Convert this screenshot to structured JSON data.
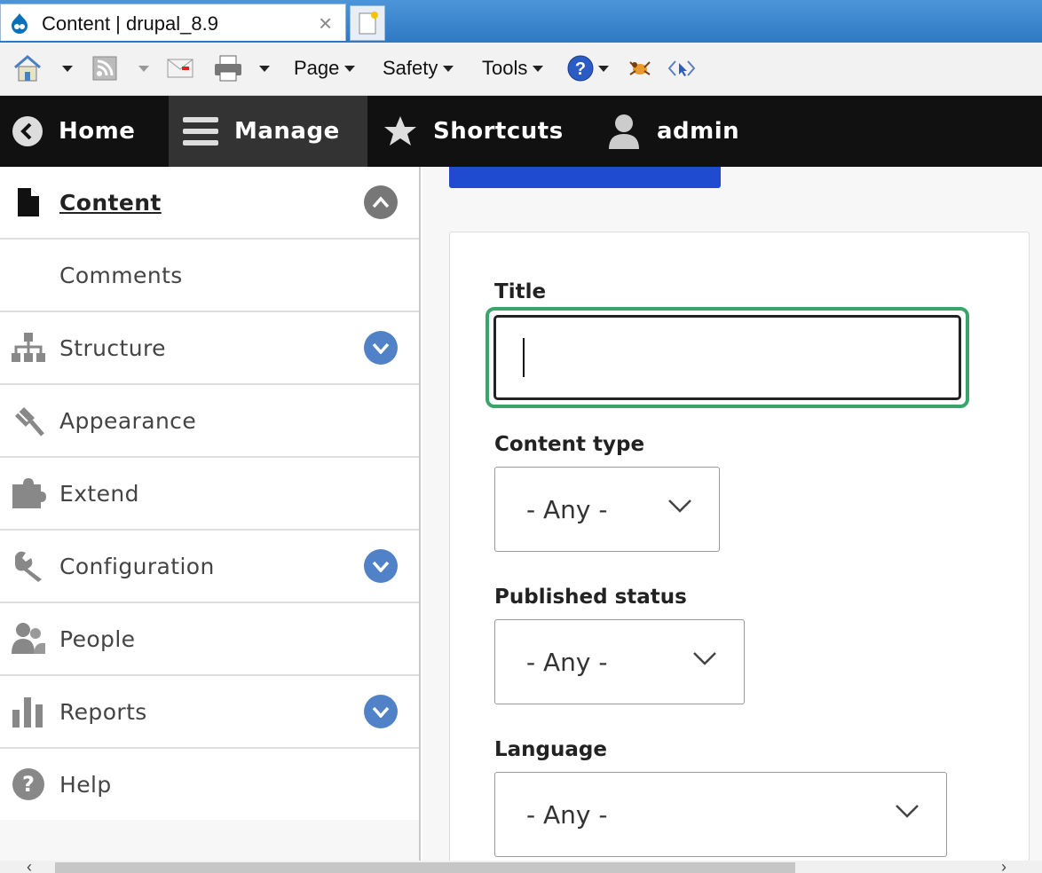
{
  "browser": {
    "tab_title": "Content | drupal_8.9",
    "tab_close": "×",
    "menu": {
      "page": "Page",
      "safety": "Safety",
      "tools": "Tools"
    }
  },
  "toolbar": {
    "home": "Home",
    "manage": "Manage",
    "shortcuts": "Shortcuts",
    "user": "admin"
  },
  "sidebar": {
    "items": [
      {
        "label": "Content",
        "icon": "file-icon",
        "expanded": true
      },
      {
        "label": "Comments"
      },
      {
        "label": "Structure",
        "icon": "sitemap-icon",
        "has_children": true
      },
      {
        "label": "Appearance",
        "icon": "paintbrush-icon"
      },
      {
        "label": "Extend",
        "icon": "puzzle-icon"
      },
      {
        "label": "Configuration",
        "icon": "wrench-icon",
        "has_children": true
      },
      {
        "label": "People",
        "icon": "people-icon"
      },
      {
        "label": "Reports",
        "icon": "bar-chart-icon",
        "has_children": true
      },
      {
        "label": "Help",
        "icon": "help-icon"
      }
    ]
  },
  "filters": {
    "title": {
      "label": "Title",
      "value": ""
    },
    "content_type": {
      "label": "Content type",
      "value": "- Any -"
    },
    "published_status": {
      "label": "Published status",
      "value": "- Any -"
    },
    "language": {
      "label": "Language",
      "value": "- Any -"
    }
  },
  "colors": {
    "toolbar_bg": "#111111",
    "accent_blue": "#5181c6",
    "focus_green": "#3aa56b",
    "primary_button": "#1f4bd1"
  }
}
